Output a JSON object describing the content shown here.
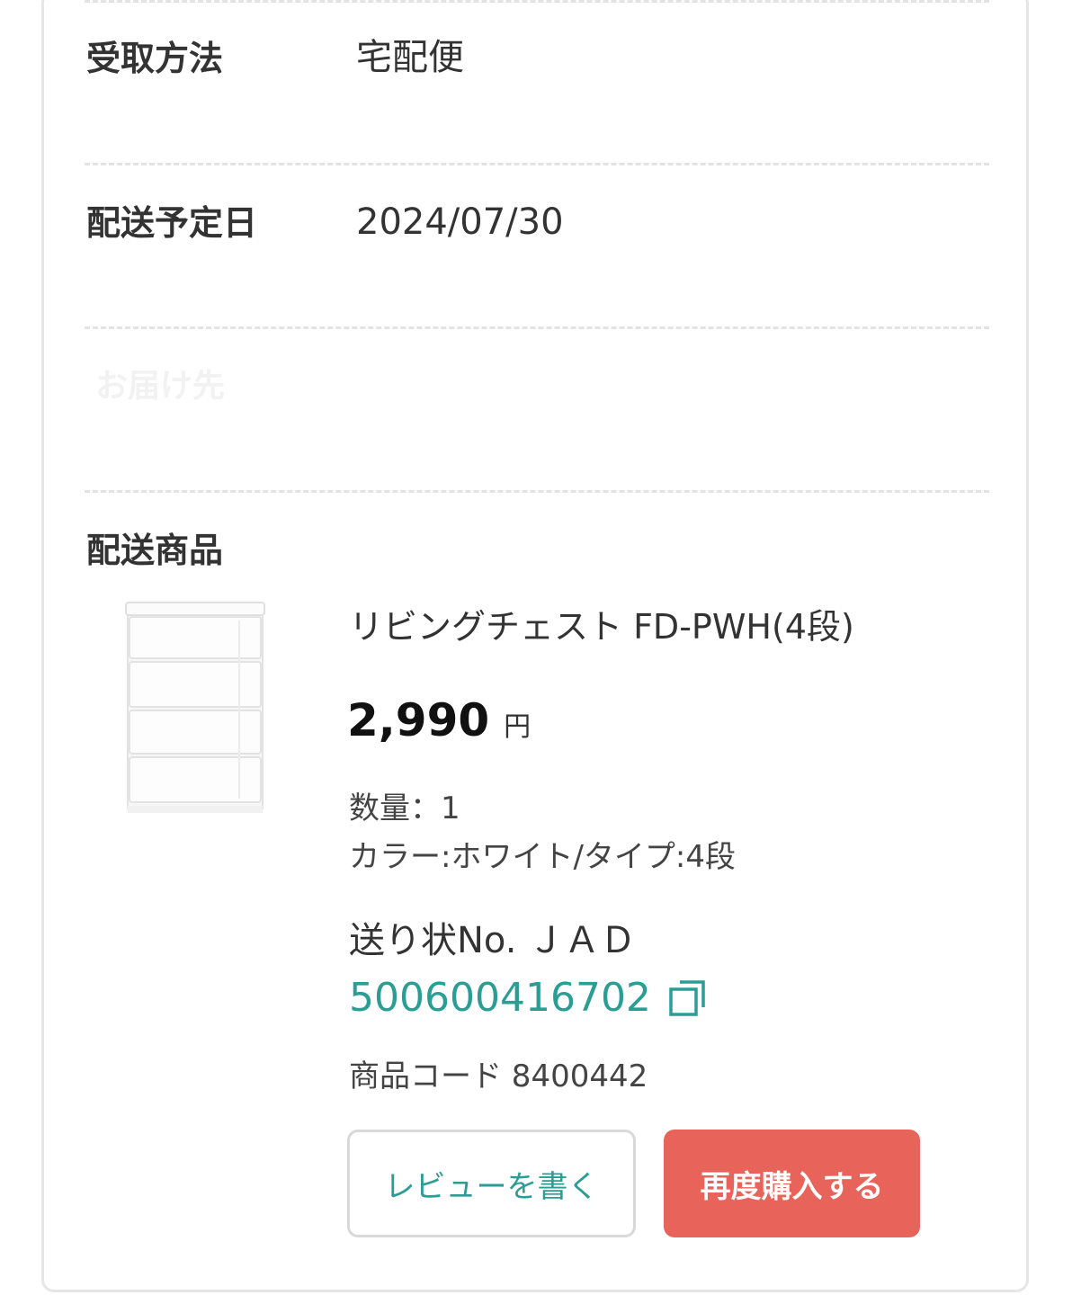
{
  "order_details": {
    "receipt_method": {
      "label": "受取方法",
      "value": "宅配便"
    },
    "delivery_date": {
      "label": "配送予定日",
      "value": "2024/07/30"
    },
    "hidden_row": {
      "label": "お届け先"
    },
    "shipped_items_label": "配送商品"
  },
  "product": {
    "image_icon": "white-4-drawer-chest",
    "name": "リビングチェスト FD-PWH(4段)",
    "price": "2,990",
    "currency": "円",
    "quantity": "数量：1",
    "variant": "カラー:ホワイト/タイプ:4段",
    "tracking_label": "送り状No. ＪＡＤ",
    "tracking_number": "500600416702",
    "copy_icon": "copy-icon",
    "product_code": "商品コード 8400442"
  },
  "actions": {
    "review_label": "レビューを書く",
    "rebuy_label": "再度購入する"
  },
  "colors": {
    "accent_teal": "#2a9d95",
    "rebuy_red": "#e8635a",
    "divider": "#e3e3e3"
  }
}
